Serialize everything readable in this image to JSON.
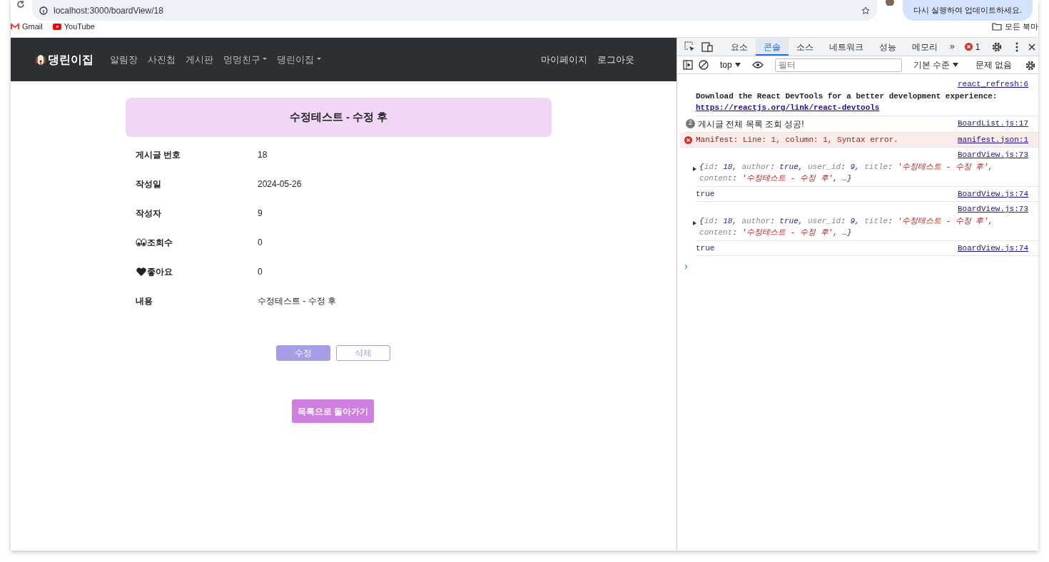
{
  "browser": {
    "address": "localhost:3000/boardView/18",
    "update_button": "다시 실행하여 업데이트하세요.",
    "bookmarks": [
      {
        "label": "Gmail",
        "kind": "gmail"
      },
      {
        "label": "YouTube",
        "kind": "youtube"
      }
    ],
    "bookmarks_folder": "모든 북마"
  },
  "navbar": {
    "brand": "댕린이집",
    "items": [
      {
        "label": "알림장",
        "dropdown": false
      },
      {
        "label": "사진첩",
        "dropdown": false
      },
      {
        "label": "게시판",
        "dropdown": false
      },
      {
        "label": "멍멍친구",
        "dropdown": true
      },
      {
        "label": "댕린이집",
        "dropdown": true
      }
    ],
    "right_items": [
      "마이페이지",
      "로그아웃"
    ]
  },
  "post": {
    "title": "수정테스트 - 수정 후",
    "fields": [
      {
        "label": "게시글 번호",
        "value": "18"
      },
      {
        "label": "작성일",
        "value": "2024-05-26"
      },
      {
        "label": "작성자",
        "value": "9"
      },
      {
        "label": "조회수",
        "value": "0",
        "kind": "views"
      },
      {
        "label": "좋아요",
        "value": "0",
        "kind": "likes"
      },
      {
        "label": "내용",
        "value": "수정테스트 - 수정 후"
      }
    ],
    "edit_button": "수정",
    "delete_button": "삭제",
    "back_button": "목록으로 돌아가기"
  },
  "devtools": {
    "tabs": [
      {
        "label": "요소",
        "selected": false
      },
      {
        "label": "콘솔",
        "selected": true
      },
      {
        "label": "소스",
        "selected": false
      },
      {
        "label": "네트워크",
        "selected": false
      },
      {
        "label": "성능",
        "selected": false
      },
      {
        "label": "메모리",
        "selected": false
      }
    ],
    "more_tabs": "»",
    "error_count": "1",
    "context": "top",
    "filter_placeholder": "필터",
    "level_menu": "기본 수준",
    "issues": "문제 없음",
    "messages": [
      {
        "kind": "log",
        "source": "react_refresh:6",
        "text": "Download the React DevTools for a better development experience: ",
        "link": "https://reactjs.org/link/react-devtools"
      },
      {
        "kind": "grouped",
        "count": "2",
        "text": "게시글 전체 목록 조회 성공!",
        "source": "BoardList.js:17"
      },
      {
        "kind": "error",
        "text": "Manifest: Line: 1, column: 1, Syntax error.",
        "source": "manifest.json:1"
      },
      {
        "kind": "object",
        "source": "BoardView.js:73",
        "tokens": [
          {
            "t": "{",
            "kind": "punct"
          },
          {
            "t": "id",
            "kind": "key"
          },
          {
            "t": ": ",
            "kind": "punct"
          },
          {
            "t": "18",
            "kind": "number"
          },
          {
            "t": ", ",
            "kind": "punct"
          },
          {
            "t": "author",
            "kind": "key"
          },
          {
            "t": ": ",
            "kind": "punct"
          },
          {
            "t": "true",
            "kind": "boolean"
          },
          {
            "t": ", ",
            "kind": "punct"
          },
          {
            "t": "user_id",
            "kind": "key"
          },
          {
            "t": ": ",
            "kind": "punct"
          },
          {
            "t": "9",
            "kind": "number"
          },
          {
            "t": ", ",
            "kind": "punct"
          },
          {
            "t": "title",
            "kind": "key"
          },
          {
            "t": ": ",
            "kind": "punct"
          },
          {
            "t": "'수정테스트 - 수정 후'",
            "kind": "string"
          },
          {
            "t": ", ",
            "kind": "punct"
          },
          {
            "t": "content",
            "kind": "key"
          },
          {
            "t": ": ",
            "kind": "punct"
          },
          {
            "t": "'수정테스트 - 수정 후'",
            "kind": "string"
          },
          {
            "t": ", …}",
            "kind": "punct"
          }
        ]
      },
      {
        "kind": "value",
        "text": "true",
        "source": "BoardView.js:74"
      },
      {
        "kind": "object",
        "source": "BoardView.js:73",
        "tokens": [
          {
            "t": "{",
            "kind": "punct"
          },
          {
            "t": "id",
            "kind": "key"
          },
          {
            "t": ": ",
            "kind": "punct"
          },
          {
            "t": "18",
            "kind": "number"
          },
          {
            "t": ", ",
            "kind": "punct"
          },
          {
            "t": "author",
            "kind": "key"
          },
          {
            "t": ": ",
            "kind": "punct"
          },
          {
            "t": "true",
            "kind": "boolean"
          },
          {
            "t": ", ",
            "kind": "punct"
          },
          {
            "t": "user_id",
            "kind": "key"
          },
          {
            "t": ": ",
            "kind": "punct"
          },
          {
            "t": "9",
            "kind": "number"
          },
          {
            "t": ", ",
            "kind": "punct"
          },
          {
            "t": "title",
            "kind": "key"
          },
          {
            "t": ": ",
            "kind": "punct"
          },
          {
            "t": "'수정테스트 - 수정 후'",
            "kind": "string"
          },
          {
            "t": ", ",
            "kind": "punct"
          },
          {
            "t": "content",
            "kind": "key"
          },
          {
            "t": ": ",
            "kind": "punct"
          },
          {
            "t": "'수정테스트 - 수정 후'",
            "kind": "string"
          },
          {
            "t": ", …}",
            "kind": "punct"
          }
        ]
      },
      {
        "kind": "value",
        "text": "true",
        "source": "BoardView.js:74"
      }
    ],
    "prompt": "›"
  }
}
